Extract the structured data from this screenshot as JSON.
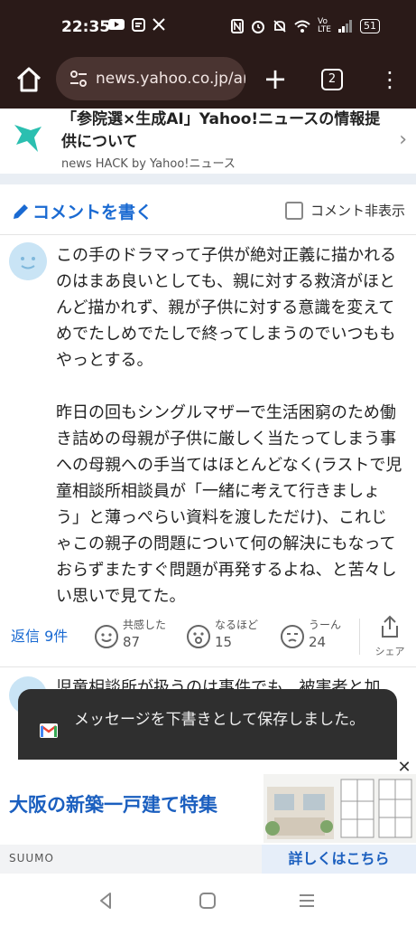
{
  "status_bar": {
    "time": "22:35",
    "left_icons": [
      "youtube-icon",
      "message-icon",
      "x-icon"
    ],
    "right_icons": [
      "nfc-icon",
      "alarm-icon",
      "mute-icon",
      "wifi-icon",
      "volte-icon",
      "signal-icon"
    ],
    "battery": "51"
  },
  "browser": {
    "url": "news.yahoo.co.jp/ar",
    "tab_count": "2"
  },
  "banner": {
    "title": "「参院選×生成AI」Yahoo!ニュースの情報提供について",
    "subtitle": "news HACK by Yahoo!ニュース"
  },
  "comment_header": {
    "write_label": "コメントを書く",
    "hide_label": "コメント非表示"
  },
  "comment": {
    "paragraphs": [
      "この手のドラマって子供が絶対正義に描かれるのはまあ良いとしても、親に対する救済がほとんど描かれず、親が子供に対する意識を変えてめでたしめでたしで終ってしまうのでいつももやっとする。",
      "昨日の回もシングルマザーで生活困窮のため働き詰めの母親が子供に厳しく当たってしまう事への母親への手当てはほとんどなく(ラストで児童相談所相談員が「一緒に考えて行きましょう」と薄っぺらい資料を渡しただけ)、これじゃこの親子の問題について何の解決にもなっておらずまたすぐ問題が再発するよね、と苦々しい思いで見てた。"
    ],
    "reply_label": "返信 9件",
    "reactions": [
      {
        "label": "共感した",
        "count": "87"
      },
      {
        "label": "なるほど",
        "count": "15"
      },
      {
        "label": "うーん",
        "count": "24"
      }
    ],
    "share_label": "シェア"
  },
  "next_comment": {
    "text": "児童相談所が扱うのは事件でも、被害者と加"
  },
  "toast": {
    "message": "メッセージを下書きとして保存しました。"
  },
  "ad": {
    "headline": "大阪の新築一戸建て特集",
    "brand": "SUUMO",
    "cta": "詳しくはこちら"
  }
}
